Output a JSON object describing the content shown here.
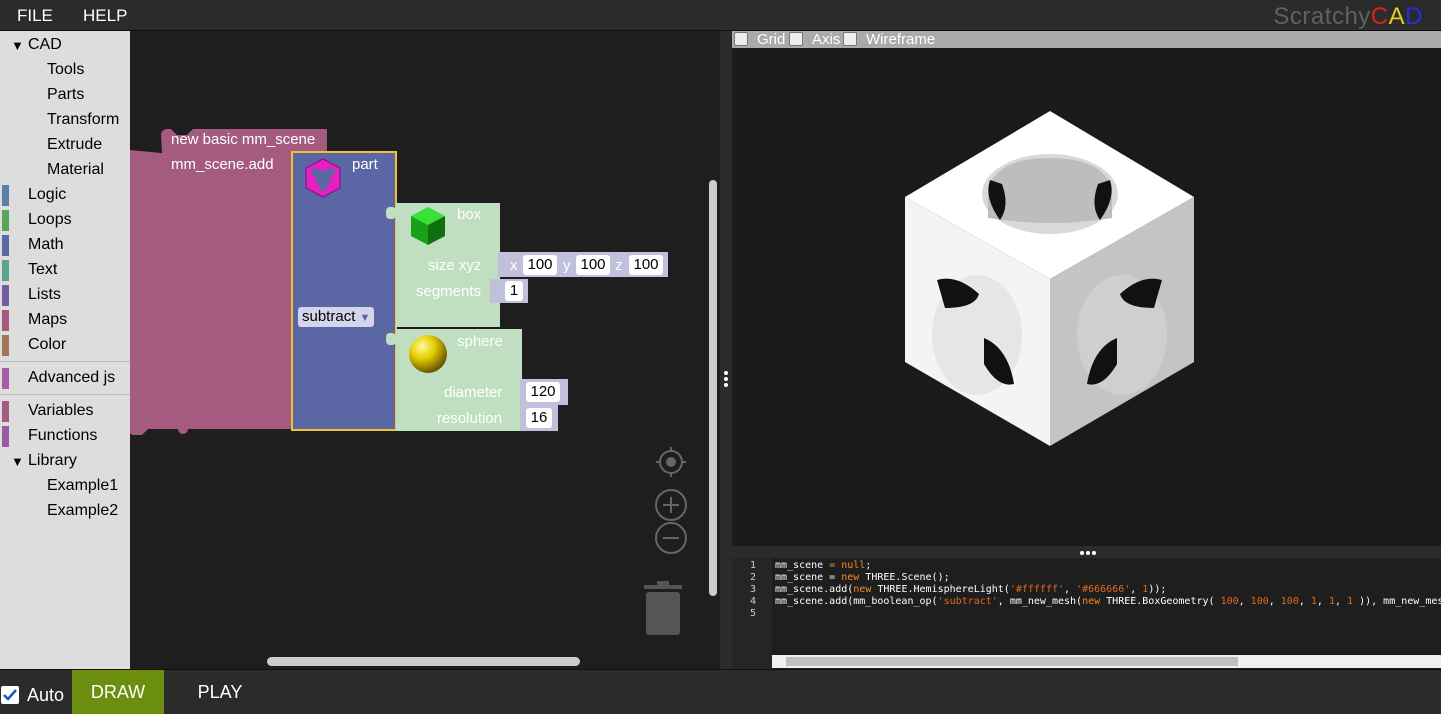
{
  "menu": {
    "file": "FILE",
    "help": "HELP"
  },
  "brand": {
    "prefix": "Scratchy",
    "c": "C",
    "a": "A",
    "d": "D"
  },
  "toolbox": {
    "cad": "CAD",
    "tools": "Tools",
    "parts": "Parts",
    "transform": "Transform",
    "extrude": "Extrude",
    "material": "Material",
    "logic": "Logic",
    "loops": "Loops",
    "math": "Math",
    "text": "Text",
    "lists": "Lists",
    "maps": "Maps",
    "color": "Color",
    "advanced": "Advanced js",
    "variables": "Variables",
    "functions": "Functions",
    "library": "Library",
    "example1": "Example1",
    "example2": "Example2",
    "colors": {
      "logic": "#5b80a5",
      "loops": "#5ba55b",
      "math": "#5b67a5",
      "text": "#5ba58c",
      "lists": "#745ba5",
      "maps": "#a55b80",
      "color": "#a5745b",
      "advanced": "#a55ba5",
      "variables": "#a55b80",
      "functions": "#995ba5"
    }
  },
  "blocks": {
    "scene": "new basic mm_scene",
    "scene_add": "mm_scene.add",
    "part": "part",
    "op": "subtract",
    "box": "box",
    "size_xyz": "size xyz",
    "x_label": "x",
    "y_label": "y",
    "z_label": "z",
    "x": "100",
    "y": "100",
    "z": "100",
    "segments_label": "segments",
    "segments": "1",
    "sphere": "sphere",
    "diameter_label": "diameter",
    "diameter": "120",
    "resolution_label": "resolution",
    "resolution": "16"
  },
  "viewer": {
    "grid": "Grid",
    "axis": "Axis",
    "wireframe": "Wireframe"
  },
  "code": {
    "lines": [
      "1",
      "2",
      "3",
      "4",
      "5"
    ],
    "l1a": "mm_scene ",
    "l1b": "= null",
    "l1c": ";",
    "l2a": "mm_scene = ",
    "l2b": "new",
    "l2c": " THREE.Scene();",
    "l3a": "mm_scene.add(",
    "l3b": "new",
    "l3c": " THREE.HemisphereLight(",
    "l3d": "'#ffffff'",
    "l3e": ", ",
    "l3f": "'#666666'",
    "l3g": ", ",
    "l3h": "1",
    "l3i": "));",
    "l4a": "mm_scene.add(mm_boolean_op(",
    "l4b": "'subtract'",
    "l4c": ", mm_new_mesh(",
    "l4d": "new",
    "l4e": " THREE.BoxGeometry( ",
    "l4f": "100",
    "l4g": ", ",
    "l4h": "100",
    "l4i": ", ",
    "l4j": "100",
    "l4k": ", ",
    "l4l": "1",
    "l4m": ", ",
    "l4n": "1",
    "l4o": ", ",
    "l4p": "1",
    "l4q": " )), mm_new_mesh("
  },
  "bottom": {
    "auto": "Auto",
    "draw": "DRAW",
    "play": "PLAY"
  }
}
